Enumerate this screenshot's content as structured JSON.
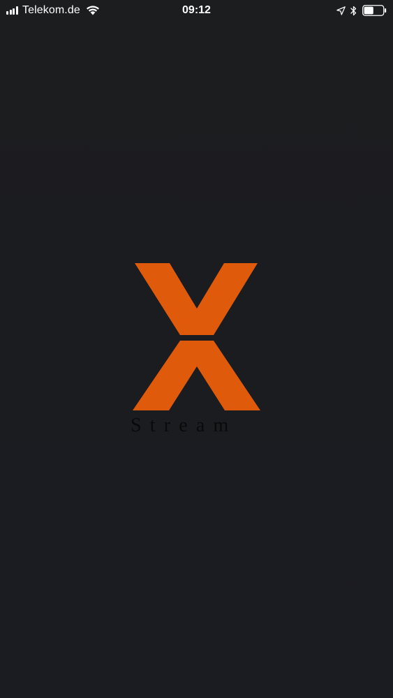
{
  "status_bar": {
    "carrier": "Telekom.de",
    "time": "09:12",
    "signal_bars": 4,
    "battery_level": 0.5,
    "icons": {
      "wifi": "wifi-icon",
      "location": "location-arrow-icon",
      "bluetooth": "bluetooth-icon",
      "battery": "battery-icon"
    }
  },
  "splash": {
    "logo_text": "Stream",
    "colors": {
      "background": "#1b1c1f",
      "accent": "#e05a0c",
      "wordmark": "#0a0a0a"
    }
  }
}
